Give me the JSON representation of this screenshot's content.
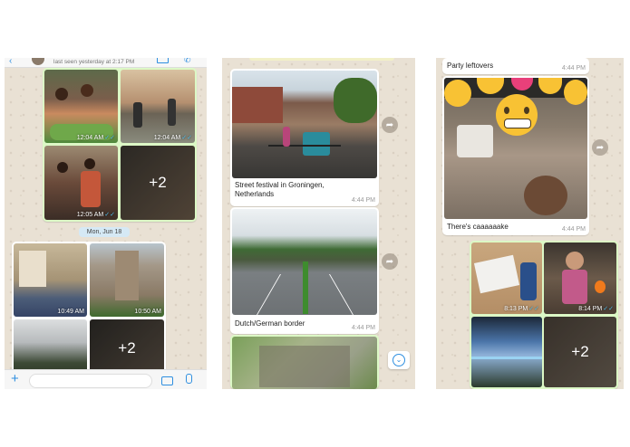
{
  "panel1": {
    "header_status": "last seen yesterday at 2:17 PM",
    "group1_times": [
      "12:04 AM",
      "12:04 AM",
      "12:05 AM"
    ],
    "group1_more": "+2",
    "date_chip": "Mon, Jun 18",
    "group2_times": [
      "10:49 AM",
      "10:50 AM"
    ],
    "group2_more": "+2",
    "colors": {
      "accent": "#2f8fe0",
      "outgoing": "#dcf8c6"
    }
  },
  "panel2": {
    "caption1": "Street festival in Groningen, Netherlands",
    "time1": "4:44 PM",
    "caption2": "Dutch/German border",
    "time2": "4:44 PM"
  },
  "panel3": {
    "caption_top": "Party leftovers",
    "time_top": "4:44 PM",
    "caption_cake": "There's caaaaaake",
    "time_cake": "4:44 PM",
    "time_grid1": "8:13 PM",
    "time_grid2": "8:14 PM",
    "more": "+2"
  }
}
